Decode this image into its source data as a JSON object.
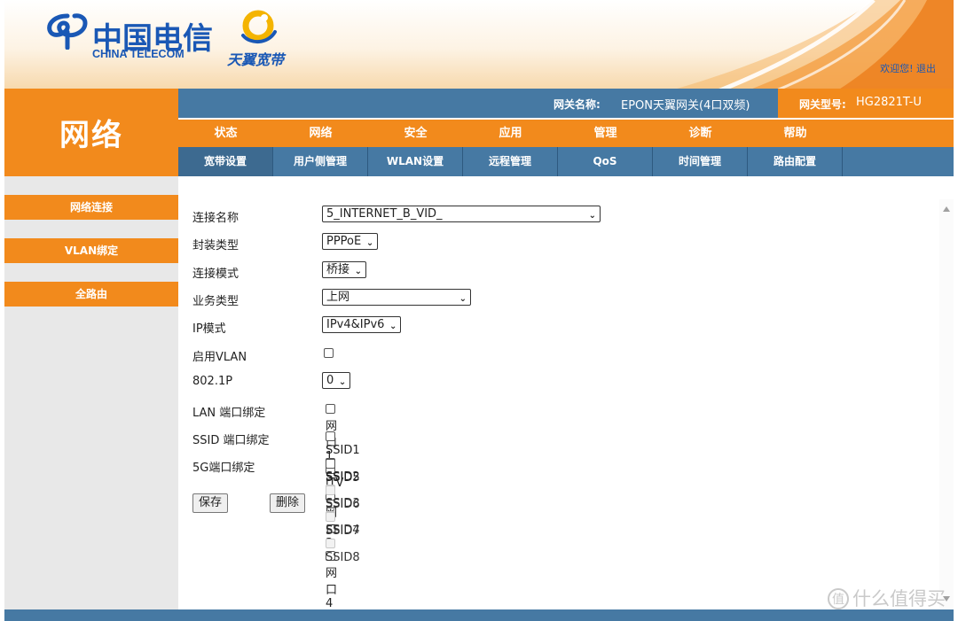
{
  "header": {
    "logo_cn": "中国电信",
    "logo_en": "CHINA TELECOM",
    "sub_brand": "天翼宽带",
    "welcome": "欢迎您!",
    "logout": "退出"
  },
  "section_title": "网络",
  "gateway": {
    "name_label": "网关名称:",
    "name": "EPON天翼网关(4口双频)",
    "type_label": "网关型号:",
    "type": "HG2821T-U"
  },
  "main_menu": [
    "状态",
    "网络",
    "安全",
    "应用",
    "管理",
    "诊断",
    "帮助"
  ],
  "sub_menu": [
    "宽带设置",
    "用户侧管理",
    "WLAN设置",
    "远程管理",
    "QoS",
    "时间管理",
    "路由配置"
  ],
  "sidebar": [
    "网络连接",
    "VLAN绑定",
    "全路由"
  ],
  "form": {
    "connection_name_label": "连接名称",
    "connection_name": "5_INTERNET_B_VID_",
    "encap_label": "封装类型",
    "encap": "PPPoE",
    "mode_label": "连接模式",
    "mode": "桥接",
    "service_label": "业务类型",
    "service": "上网",
    "ip_mode_label": "IP模式",
    "ip_mode": "IPv4&IPv6",
    "vlan_label": "启用VLAN",
    "p8021_label": "802.1P",
    "p8021": "0",
    "lan_bind_label": "LAN 端口绑定",
    "lan_ports": [
      "网口1",
      "iTV",
      "网口3",
      "网口4"
    ],
    "ssid_bind_label": "SSID 端口绑定",
    "ssid_ports": [
      "SSID1",
      "SSID2",
      "SSID3",
      "SSID4"
    ],
    "ssid5g_bind_label": "5G端口绑定",
    "ssid5g_ports": [
      "SSID5",
      "SSID6",
      "SSID7",
      "SSID8"
    ],
    "save": "保存",
    "delete": "删除"
  },
  "watermark": "什么值得买",
  "watermark_icon": "值",
  "colors": {
    "orange": "#f28a1c",
    "blue": "#4679a3",
    "brand_blue": "#1a58b5"
  }
}
